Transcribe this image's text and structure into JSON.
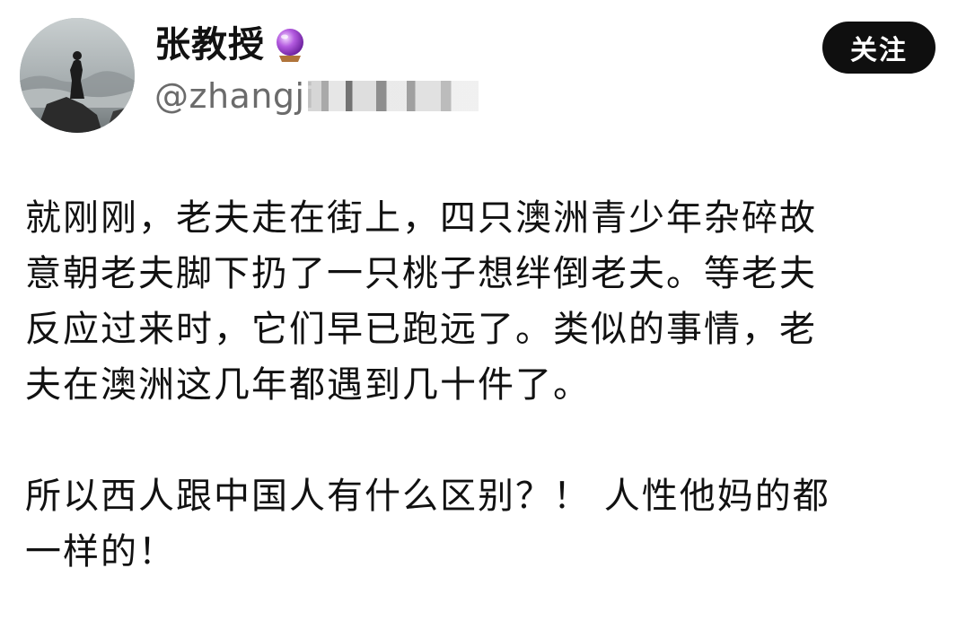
{
  "author": {
    "display_name": "张教授",
    "handle": "@zhangji",
    "badge_icon": "crystal-ball-icon"
  },
  "actions": {
    "follow_label": "关注"
  },
  "post": {
    "paragraph_1": "就刚刚，老夫走在街上，四只澳洲青少年杂碎故\n意朝老夫脚下扔了一只桃子想绊倒老夫。等老夫\n反应过来时，它们早已跑远了。类似的事情，老\n夫在澳洲这几年都遇到几十件了。",
    "paragraph_2": "所以西人跟中国人有什么区别？！ 人性他妈的都\n一样的！"
  },
  "colors": {
    "follow_button_bg": "#0f0f0f",
    "handle_text": "#6b6b6b",
    "body_text": "#111111"
  }
}
